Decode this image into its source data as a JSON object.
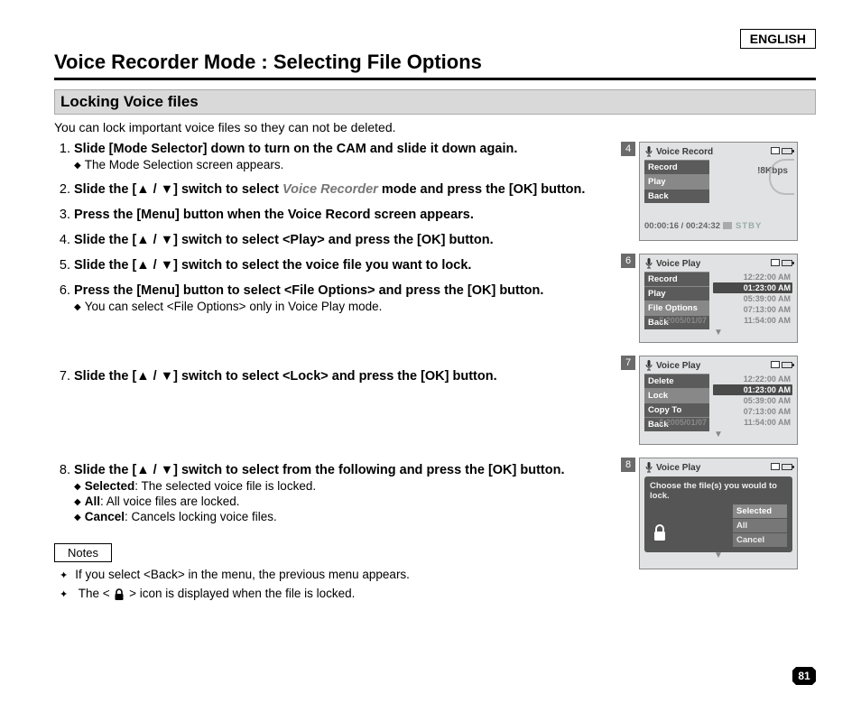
{
  "lang": "ENGLISH",
  "page_title": "Voice Recorder Mode : Selecting File Options",
  "section_title": "Locking Voice files",
  "intro": "You can lock important voice files so they can not be deleted.",
  "steps": {
    "s1": {
      "head": "Slide [Mode Selector] down to turn on the CAM and slide it down again.",
      "sub": "The Mode Selection screen appears."
    },
    "s2": {
      "head_a": "Slide the [",
      "head_b": "] switch to select ",
      "mode": "Voice Recorder",
      "head_c": " mode and press the [OK] button."
    },
    "s3": {
      "head": "Press the [Menu] button when the Voice Record screen appears."
    },
    "s4": {
      "head_a": "Slide the [",
      "head_b": "] switch to select <Play> and press the [OK] button."
    },
    "s5": {
      "head_a": "Slide the [",
      "head_b": "] switch to select the voice file you want to lock."
    },
    "s6": {
      "head": "Press the [Menu] button to select <File Options> and press the [OK] button.",
      "sub": "You can select <File Options> only in Voice Play mode."
    },
    "s7": {
      "head_a": "Slide the [",
      "head_b": "] switch to select <Lock> and press the [OK] button."
    },
    "s8": {
      "head_a": "Slide the [",
      "head_b": "] switch to select from the following and press the [OK] button.",
      "sub_selected_lbl": "Selected",
      "sub_selected_txt": ": The selected voice file is locked.",
      "sub_all_lbl": "All",
      "sub_all_txt": ": All voice files are locked.",
      "sub_cancel_lbl": "Cancel",
      "sub_cancel_txt": ": Cancels locking voice files."
    }
  },
  "notes_label": "Notes",
  "notes": {
    "n1": "If you select <Back> in the menu, the previous menu appears.",
    "n2_a": "The < ",
    "n2_b": " > icon is displayed when the file is locked."
  },
  "udarr": "▲ / ▼",
  "shots": {
    "s4": {
      "num": "4",
      "header": "Voice Record",
      "menu": [
        "Record",
        "Play",
        "Back"
      ],
      "bitrate": "!8Kbps",
      "time": "00:00:16 / 00:24:32",
      "state": "STBY"
    },
    "s6": {
      "num": "6",
      "header": "Voice Play",
      "menu": [
        "Record",
        "Play",
        "File Options",
        "Back"
      ],
      "files": [
        {
          "d": "",
          "t": "12:22:00 AM"
        },
        {
          "d": "",
          "t": "01:23:00 AM"
        },
        {
          "d": "",
          "t": "05:39:00 AM"
        },
        {
          "d": "",
          "t": "07:13:00 AM"
        },
        {
          "d": "5  2005/01/07",
          "t": "11:54:00 AM"
        }
      ]
    },
    "s7": {
      "num": "7",
      "header": "Voice Play",
      "menu": [
        "Delete",
        "Lock",
        "Copy To",
        "Back"
      ],
      "files": [
        {
          "d": "",
          "t": "12:22:00 AM"
        },
        {
          "d": "",
          "t": "01:23:00 AM"
        },
        {
          "d": "",
          "t": "05:39:00 AM"
        },
        {
          "d": "",
          "t": "07:13:00 AM"
        },
        {
          "d": "5  2005/01/07",
          "t": "11:54:00 AM"
        }
      ]
    },
    "s8": {
      "num": "8",
      "header": "Voice Play",
      "dialog_text": "Choose the file(s) you would to lock.",
      "options": [
        "Selected",
        "All",
        "Cancel"
      ]
    }
  },
  "page_num": "81"
}
